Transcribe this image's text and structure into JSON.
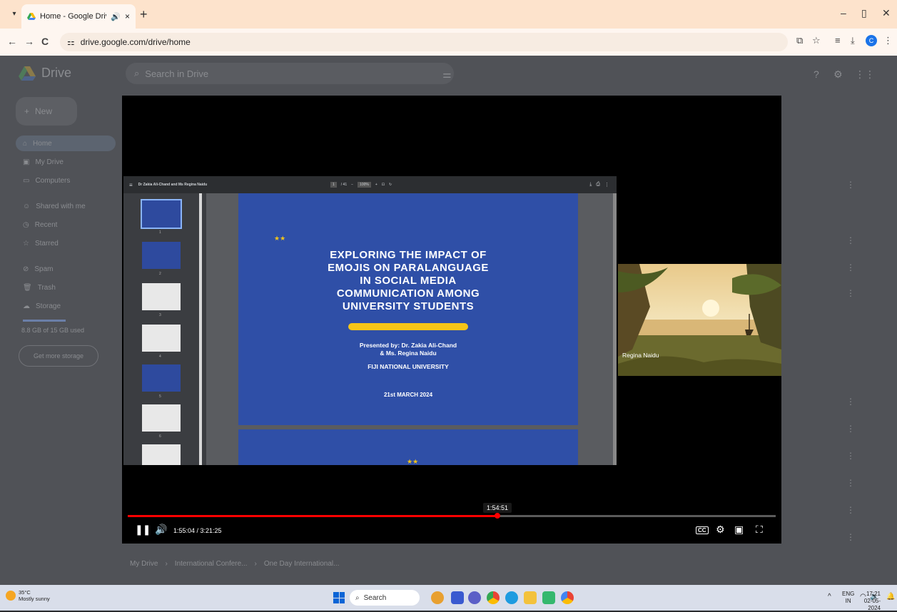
{
  "browser": {
    "tab_title": "Home - Google Drive",
    "url": "drive.google.com/drive/home",
    "menu_glyph": "▾",
    "new_tab_glyph": "+",
    "close_glyph": "×",
    "audio_glyph": "🔊",
    "minimize_glyph": "–",
    "maximize_glyph": "▯",
    "window_close_glyph": "✕",
    "back_glyph": "←",
    "forward_glyph": "→",
    "reload_glyph": "C",
    "site_info_glyph": "⚏",
    "profile_initial": "C"
  },
  "drive": {
    "logo_text": "Drive",
    "search_placeholder": "Search in Drive",
    "new_label": "New",
    "sidebar": [
      {
        "label": "Home",
        "icon": "home-icon"
      },
      {
        "label": "My Drive",
        "icon": "my-drive-icon"
      },
      {
        "label": "Computers",
        "icon": "computers-icon"
      },
      {
        "label": "Shared with me",
        "icon": "shared-icon"
      },
      {
        "label": "Recent",
        "icon": "recent-icon"
      },
      {
        "label": "Starred",
        "icon": "star-icon"
      },
      {
        "label": "Spam",
        "icon": "spam-icon"
      },
      {
        "label": "Trash",
        "icon": "trash-icon"
      },
      {
        "label": "Storage",
        "icon": "storage-icon"
      }
    ],
    "storage_text": "8.8 GB of 15 GB used",
    "get_storage_label": "Get more storage",
    "breadcrumb": [
      "My Drive",
      "International Confere...",
      "One Day International..."
    ]
  },
  "pdf": {
    "doc_title": "Dr Zakia Ali-Chand and Ms Regina Naidu",
    "page_current": "1",
    "page_total": "/ 41",
    "zoom": "100%"
  },
  "slide": {
    "stars": "★★",
    "title": "EXPLORING THE IMPACT OF\nEMOJIS ON PARALANGUAGE\nIN SOCIAL MEDIA\nCOMMUNICATION AMONG\nUNIVERSITY STUDENTS",
    "presented": "Presented by: Dr. Zakia Ali-Chand\n& Ms. Regina Naidu",
    "university": "FIJI NATIONAL UNIVERSITY",
    "date": "21st MARCH 2024"
  },
  "webcam": {
    "participant_name": "Regina Naidu"
  },
  "player": {
    "hover_time": "1:54:51",
    "current_time": "1:55:04",
    "duration": "3:21:25",
    "time_display": "1:55:04 / 3:21:25",
    "progress_fraction": 0.5701,
    "cc_label": "CC"
  },
  "taskbar": {
    "temperature": "35°C",
    "weather": "Mostly sunny",
    "search_label": "Search",
    "lang_top": "ENG",
    "lang_bottom": "IN",
    "time": "17:21",
    "date": "02-05-2024"
  },
  "colors": {
    "progress": "#ff0000",
    "slide_bg": "#2f4fa7",
    "slide_accent": "#f5c518",
    "tabstrip": "#fde3cc"
  }
}
